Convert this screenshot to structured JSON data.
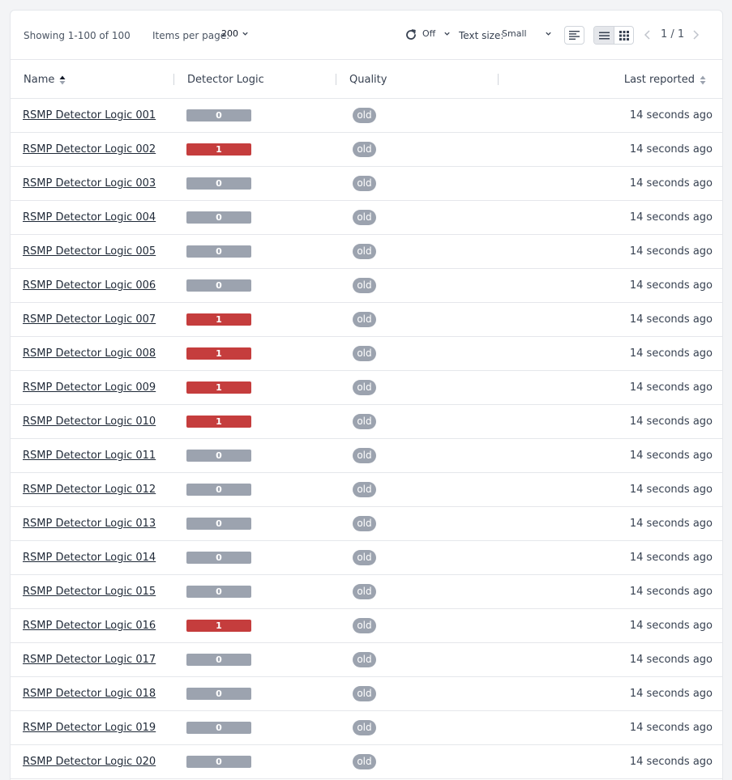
{
  "toolbar": {
    "showing": "Showing 1-100 of 100",
    "items_per_page_label": "Items per page:",
    "items_per_page_value": "200",
    "refresh_value": "Off",
    "text_size_label": "Text size:",
    "text_size_value": "Small",
    "pagination": "1 / 1"
  },
  "columns": {
    "name": "Name",
    "detector_logic": "Detector Logic",
    "quality": "Quality",
    "last_reported": "Last reported"
  },
  "colors": {
    "value_0": "#9ca3af",
    "value_1": "#c53d3d",
    "quality_pill": "#9ca3af"
  },
  "rows": [
    {
      "name": "RSMP Detector Logic 001",
      "value": "0",
      "quality": "old",
      "last_reported": "14 seconds ago"
    },
    {
      "name": "RSMP Detector Logic 002",
      "value": "1",
      "quality": "old",
      "last_reported": "14 seconds ago"
    },
    {
      "name": "RSMP Detector Logic 003",
      "value": "0",
      "quality": "old",
      "last_reported": "14 seconds ago"
    },
    {
      "name": "RSMP Detector Logic 004",
      "value": "0",
      "quality": "old",
      "last_reported": "14 seconds ago"
    },
    {
      "name": "RSMP Detector Logic 005",
      "value": "0",
      "quality": "old",
      "last_reported": "14 seconds ago"
    },
    {
      "name": "RSMP Detector Logic 006",
      "value": "0",
      "quality": "old",
      "last_reported": "14 seconds ago"
    },
    {
      "name": "RSMP Detector Logic 007",
      "value": "1",
      "quality": "old",
      "last_reported": "14 seconds ago"
    },
    {
      "name": "RSMP Detector Logic 008",
      "value": "1",
      "quality": "old",
      "last_reported": "14 seconds ago"
    },
    {
      "name": "RSMP Detector Logic 009",
      "value": "1",
      "quality": "old",
      "last_reported": "14 seconds ago"
    },
    {
      "name": "RSMP Detector Logic 010",
      "value": "1",
      "quality": "old",
      "last_reported": "14 seconds ago"
    },
    {
      "name": "RSMP Detector Logic 011",
      "value": "0",
      "quality": "old",
      "last_reported": "14 seconds ago"
    },
    {
      "name": "RSMP Detector Logic 012",
      "value": "0",
      "quality": "old",
      "last_reported": "14 seconds ago"
    },
    {
      "name": "RSMP Detector Logic 013",
      "value": "0",
      "quality": "old",
      "last_reported": "14 seconds ago"
    },
    {
      "name": "RSMP Detector Logic 014",
      "value": "0",
      "quality": "old",
      "last_reported": "14 seconds ago"
    },
    {
      "name": "RSMP Detector Logic 015",
      "value": "0",
      "quality": "old",
      "last_reported": "14 seconds ago"
    },
    {
      "name": "RSMP Detector Logic 016",
      "value": "1",
      "quality": "old",
      "last_reported": "14 seconds ago"
    },
    {
      "name": "RSMP Detector Logic 017",
      "value": "0",
      "quality": "old",
      "last_reported": "14 seconds ago"
    },
    {
      "name": "RSMP Detector Logic 018",
      "value": "0",
      "quality": "old",
      "last_reported": "14 seconds ago"
    },
    {
      "name": "RSMP Detector Logic 019",
      "value": "0",
      "quality": "old",
      "last_reported": "14 seconds ago"
    },
    {
      "name": "RSMP Detector Logic 020",
      "value": "0",
      "quality": "old",
      "last_reported": "14 seconds ago"
    }
  ]
}
